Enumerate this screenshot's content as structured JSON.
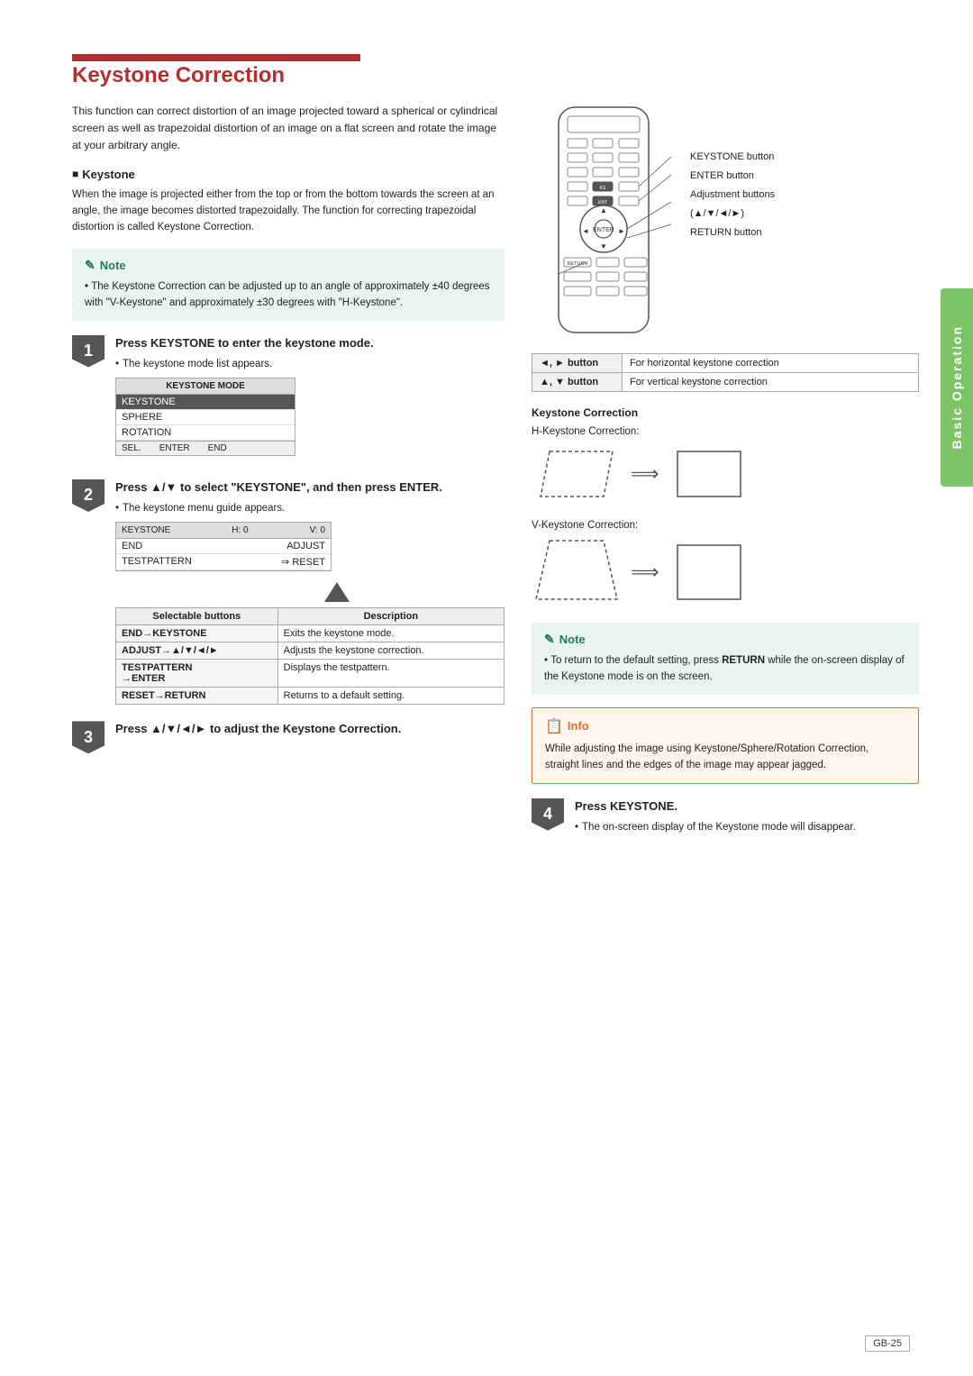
{
  "page": {
    "title": "Keystone Correction",
    "tab_label": "Basic Operation",
    "page_number": "GB-25",
    "intro_text": "This function can correct distortion of an image projected toward a spherical or cylindrical screen as well as trapezoidal distortion of an image on a flat screen and rotate the image at your arbitrary angle.",
    "keystone_section": {
      "heading": "Keystone",
      "text": "When the image is projected either from the top or from the bottom towards the screen at an angle, the image becomes distorted trapezoidally. The function for correcting trapezoidal distortion is called Keystone Correction."
    },
    "note": {
      "title": "Note",
      "text": "The Keystone Correction can be adjusted up to an angle of approximately ±40 degrees with \"V-Keystone\" and approximately ±30 degrees with \"H-Keystone\"."
    },
    "steps": [
      {
        "number": "1",
        "title_parts": [
          "Press ",
          "KEYSTONE",
          " to enter the keystone mode."
        ],
        "bullet": "The keystone mode list appears.",
        "menu": {
          "header": "KEYSTONE MODE",
          "rows": [
            "KEYSTONE",
            "SPHERE",
            "ROTATION"
          ],
          "selected": 0,
          "footer": [
            "SEL.",
            "ENTER",
            "END"
          ]
        }
      },
      {
        "number": "2",
        "title_parts": [
          "Press ▲/▼ to select \"KEYSTONE\", and then press ",
          "ENTER",
          "."
        ],
        "bullet": "The keystone menu guide appears.",
        "ks_menu": {
          "header": [
            "KEYSTONE",
            "H: 0",
            "V: 0"
          ],
          "rows": [
            {
              "col1": "END",
              "col2": "ADJUST"
            },
            {
              "col1": "TESTPATTERN",
              "col2": "⇒ RESET"
            }
          ]
        },
        "table": {
          "headers": [
            "Selectable buttons",
            "Description"
          ],
          "rows": [
            {
              "btn": "END→KEYSTONE",
              "desc": "Exits the keystone mode."
            },
            {
              "btn": "ADJUST→▲/▼/◄/►",
              "desc": "Adjusts the keystone correction."
            },
            {
              "btn": "TESTPATTERN →ENTER",
              "desc": "Displays the testpattern."
            },
            {
              "btn": "RESET→RETURN",
              "desc": "Returns to a default setting."
            }
          ]
        }
      },
      {
        "number": "3",
        "title_parts": [
          "Press ▲/▼/◄/► to adjust the Keystone Correction."
        ]
      }
    ],
    "right_col": {
      "remote_labels": {
        "keystone_button": "KEYSTONE button",
        "enter_button": "ENTER button",
        "adjustment_buttons": "Adjustment buttons",
        "adjustment_symbols": "(▲/▼/◄/►)",
        "return_button": "RETURN button"
      },
      "btn_table": {
        "rows": [
          {
            "btn": "◄, ► button",
            "desc": "For horizontal keystone correction"
          },
          {
            "btn": "▲, ▼ button",
            "desc": "For vertical keystone correction"
          }
        ]
      },
      "keystone_correction_label": "Keystone Correction",
      "h_keystone_label": "H-Keystone Correction:",
      "v_keystone_label": "V-Keystone Correction:",
      "note2": {
        "title": "Note",
        "text": "To return to the default setting, press RETURN while the on-screen display of the Keystone mode is on the screen."
      },
      "info": {
        "title": "Info",
        "text": "While adjusting the image using Keystone/Sphere/Rotation Correction, straight lines and the edges of the image may appear jagged."
      }
    },
    "step4": {
      "number": "4",
      "title_parts": [
        "Press ",
        "KEYSTONE",
        "."
      ],
      "bullet": "The on-screen display of the Keystone mode will disappear."
    }
  }
}
